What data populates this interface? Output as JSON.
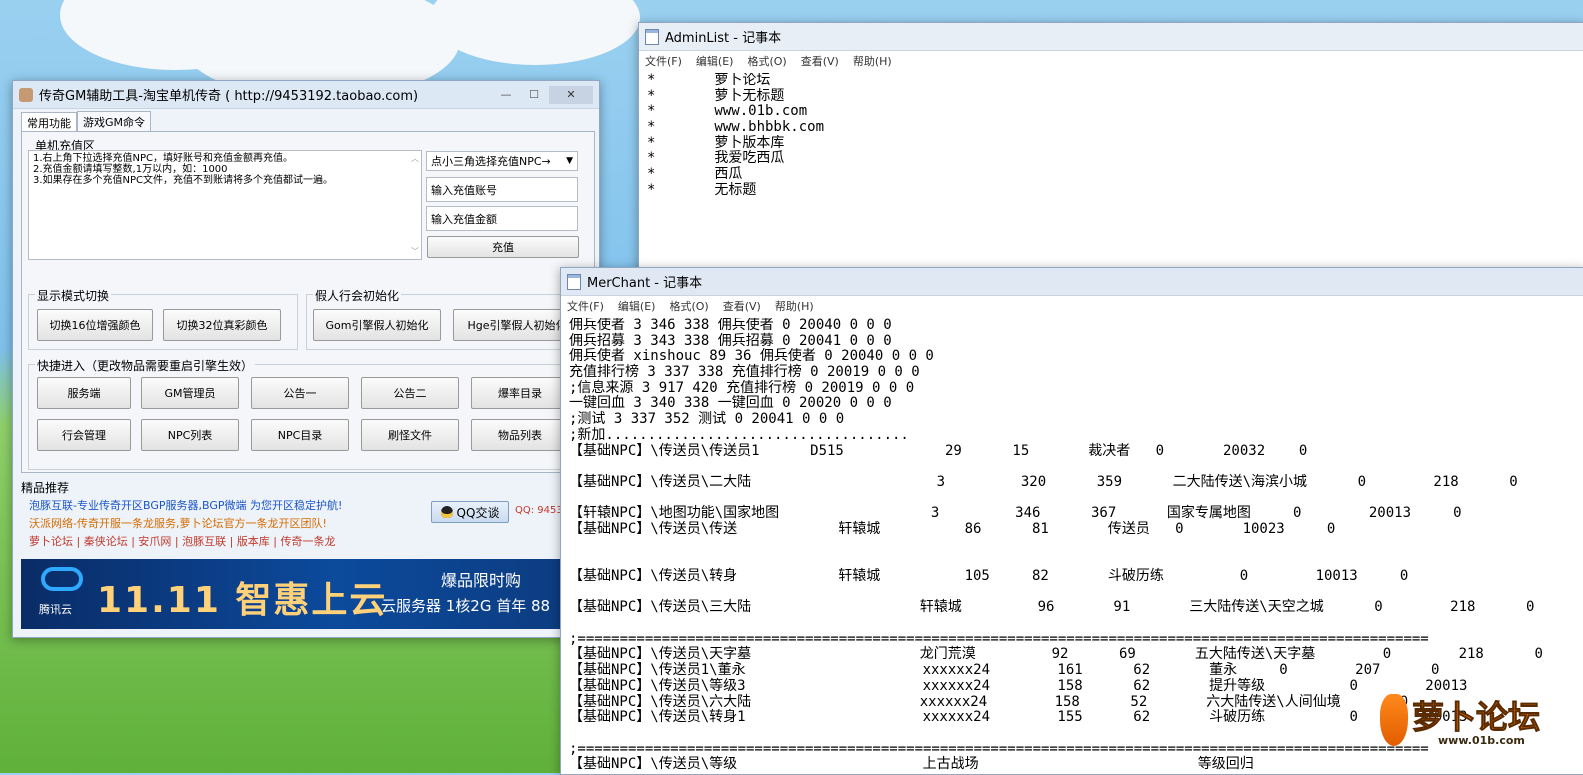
{
  "gm_tool": {
    "title": "传奇GM辅助工具-淘宝单机传奇 ( http://9453192.taobao.com)",
    "tabs": [
      "常用功能",
      "游戏GM命令"
    ],
    "recharge": {
      "group_title": "单机充值区",
      "instructions": [
        "1.右上角下拉选择充值NPC，填好账号和充值金额再充值。",
        "2.充值金额请填写整数,1万以内，如：1000",
        "3.如果存在多个充值NPC文件，充值不到账请将多个充值都试一遍。"
      ],
      "npc_select": "点小三角选择充值NPC→",
      "account_placeholder": "输入充值账号",
      "amount_placeholder": "输入充值金额",
      "submit_label": "充值"
    },
    "display_mode": {
      "group_title": "显示模式切换",
      "btn_16": "切换16位增强颜色",
      "btn_32": "切换32位真彩颜色"
    },
    "guild_init": {
      "group_title": "假人行会初始化",
      "btn_gom": "Gom引擎假人初始化",
      "btn_hge": "Hge引擎假人初始化"
    },
    "quick_access": {
      "group_title": "快捷进入（更改物品需要重启引擎生效）",
      "row1": [
        "服务端",
        "GM管理员",
        "公告一",
        "公告二",
        "爆率目录"
      ],
      "row2": [
        "行会管理",
        "NPC列表",
        "NPC目录",
        "刷怪文件",
        "物品列表"
      ]
    },
    "recommend": {
      "title": "精品推荐",
      "line1": "泡豚互联-专业传奇开区BGP服务器,BGP微端 为您开区稳定护航!",
      "line2": "沃派网络-传奇开服一条龙服务,萝卜论坛官方一条龙开区团队!",
      "links": [
        "萝卜论坛",
        "秦侠论坛",
        "安爪网",
        "泡豚互联",
        "版本库",
        "传奇一条龙"
      ],
      "qq_button": "QQ交谈",
      "qq_number": "QQ: 9453"
    },
    "banner": {
      "brand": "腾讯云",
      "headline": "11.11 智惠上云",
      "tag": "爆品限时购",
      "sub": "云服务器 1核2G 首年 88"
    }
  },
  "admin_list": {
    "title": "AdminList - 记事本",
    "menu": [
      "文件(F)",
      "编辑(E)",
      "格式(O)",
      "查看(V)",
      "帮助(H)"
    ],
    "lines": [
      "*       萝卜论坛",
      "*       萝卜无标题",
      "*       www.01b.com",
      "*       www.bhbbk.com",
      "*       萝卜版本库",
      "*       我爱吃西瓜",
      "*       西瓜",
      "*       无标题"
    ]
  },
  "merchant": {
    "title": "MerChant - 记事本",
    "menu": [
      "文件(F)",
      "编辑(E)",
      "格式(O)",
      "查看(V)",
      "帮助(H)"
    ],
    "lines": [
      "佣兵使者 3 346 338 佣兵使者 0 20040 0 0 0",
      "佣兵招募 3 343 338 佣兵招募 0 20041 0 0 0",
      "佣兵使者 xinshouc 89 36 佣兵使者 0 20040 0 0 0",
      "充值排行榜 3 337 338 充值排行榜 0 20019 0 0 0",
      ";信息来源 3 917 420 充值排行榜 0 20019 0 0 0",
      "一键回血 3 340 338 一键回血 0 20020 0 0 0",
      ";测试 3 337 352 测试 0 20041 0 0 0",
      ";新加....................................",
      "【基础NPC】\\传送员\\传送员1      D515            29      15       裁决者   0       20032    0",
      "",
      "【基础NPC】\\传送员\\二大陆                      3         320      359      二大陆传送\\海滨小城      0        218      0",
      "",
      "【轩辕NPC】\\地图功能\\国家地图                  3         346      367      国家专属地图     0        20013     0",
      "【基础NPC】\\传送员\\传送            轩辕城          86      81       传送员   0       10023     0",
      "",
      "",
      "【基础NPC】\\传送员\\转身            轩辕城          105     82       斗破历练         0        10013     0",
      "",
      "【基础NPC】\\传送员\\三大陆                    轩辕城         96       91       三大陆传送\\天空之城      0        218      0",
      "",
      ";=====================================================================================================",
      "【基础NPC】\\传送员\\天字墓                    龙门荒漠         92      69       五大陆传送\\天字墓        0        218      0",
      "【基础NPC】\\传送员1\\董永                     xxxxxx24        161      62       董永     0        207      0",
      "【基础NPC】\\传送员\\等级3                     xxxxxx24        158      62       提升等级          0        20013",
      "【基础NPC】\\传送员\\六大陆                    xxxxxx24        158      52       六大陆传送\\人间仙境       0",
      "【基础NPC】\\传送员\\转身1                     xxxxxx24        155      62       斗破历练          0        10013",
      "",
      ";=====================================================================================================",
      "【基础NPC】\\传送员\\等级                      上古战场                          等级回归"
    ]
  },
  "watermark": {
    "text": "萝卜论坛",
    "sub": "www.01b.com"
  }
}
